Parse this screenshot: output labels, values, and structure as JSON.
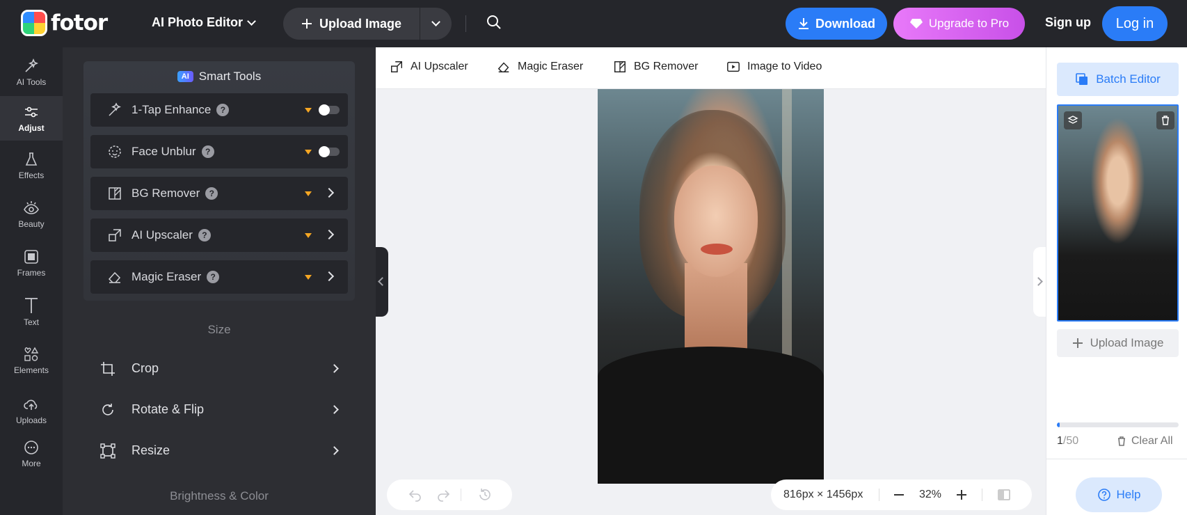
{
  "brand": {
    "name": "fotor"
  },
  "header": {
    "editor_menu": "AI Photo Editor",
    "upload_label": "Upload Image",
    "download_label": "Download",
    "upgrade_label": "Upgrade to Pro",
    "signup_label": "Sign up",
    "login_label": "Log in"
  },
  "leftnav": {
    "items": [
      {
        "label": "AI Tools",
        "icon": "sparkle-wand-icon"
      },
      {
        "label": "Adjust",
        "icon": "sliders-icon",
        "active": true
      },
      {
        "label": "Effects",
        "icon": "flask-icon"
      },
      {
        "label": "Beauty",
        "icon": "eye-icon"
      },
      {
        "label": "Frames",
        "icon": "frame-icon"
      },
      {
        "label": "Text",
        "icon": "text-t-icon"
      },
      {
        "label": "Elements",
        "icon": "shapes-icon"
      },
      {
        "label": "Uploads",
        "icon": "cloud-upload-icon"
      },
      {
        "label": "More",
        "icon": "more-dots-icon"
      }
    ]
  },
  "smart_tools": {
    "badge": "AI",
    "title": "Smart Tools",
    "tools": [
      {
        "label": "1-Tap Enhance",
        "control": "toggle",
        "enabled": false
      },
      {
        "label": "Face Unblur",
        "control": "toggle",
        "enabled": false
      },
      {
        "label": "BG Remover",
        "control": "chevron"
      },
      {
        "label": "AI Upscaler",
        "control": "chevron"
      },
      {
        "label": "Magic Eraser",
        "control": "chevron"
      }
    ],
    "help_glyph": "?"
  },
  "size_section": {
    "title": "Size",
    "items": [
      {
        "label": "Crop"
      },
      {
        "label": "Rotate & Flip"
      },
      {
        "label": "Resize"
      }
    ]
  },
  "brightness_section": {
    "title": "Brightness & Color"
  },
  "quick_tools": [
    {
      "label": "AI Upscaler"
    },
    {
      "label": "Magic Eraser"
    },
    {
      "label": "BG Remover"
    },
    {
      "label": "Image to Video"
    }
  ],
  "canvas": {
    "dimensions": "816px × 1456px",
    "zoom": "32%"
  },
  "right_panel": {
    "batch_label": "Batch Editor",
    "upload_label": "Upload Image",
    "count_current": "1",
    "count_total": "/50",
    "progress_fraction": 0.02,
    "clear_label": "Clear All",
    "help_label": "Help"
  },
  "colors": {
    "accent": "#2a7cf7",
    "dark_bg": "#25262b",
    "panel_bg": "#2d2e33",
    "pro_gradient": "#e879f9"
  }
}
